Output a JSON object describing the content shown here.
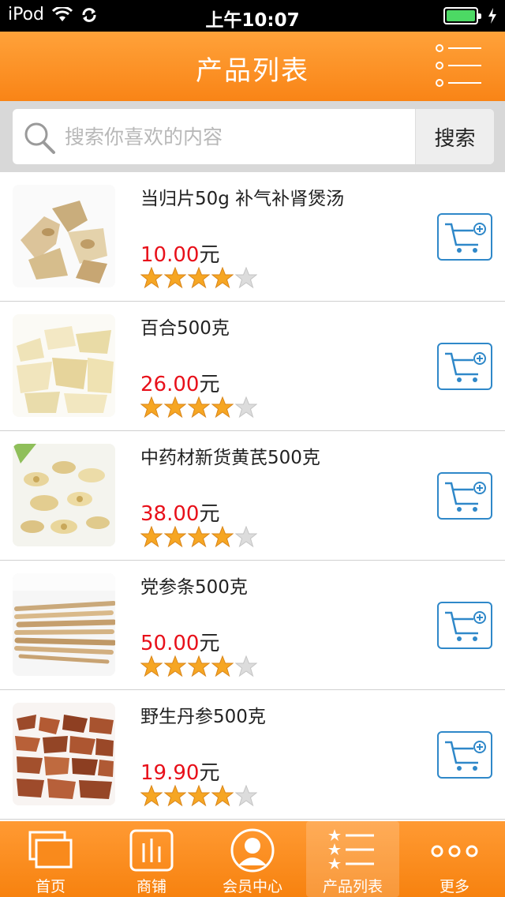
{
  "status_bar": {
    "carrier": "iPod",
    "time": "上午10:07"
  },
  "nav": {
    "title": "产品列表"
  },
  "search": {
    "placeholder": "搜索你喜欢的内容",
    "button_label": "搜索"
  },
  "products": [
    {
      "name": "当归片50g 补气补肾煲汤",
      "price": "10.00",
      "unit": "元",
      "rating": 4,
      "max_rating": 5
    },
    {
      "name": "百合500克",
      "price": "26.00",
      "unit": "元",
      "rating": 4,
      "max_rating": 5
    },
    {
      "name": "中药材新货黄芪500克",
      "price": "38.00",
      "unit": "元",
      "rating": 4,
      "max_rating": 5
    },
    {
      "name": "党参条500克",
      "price": "50.00",
      "unit": "元",
      "rating": 4,
      "max_rating": 5
    },
    {
      "name": "野生丹参500克",
      "price": "19.90",
      "unit": "元",
      "rating": 4,
      "max_rating": 5
    }
  ],
  "tabs": [
    {
      "label": "首页",
      "icon": "window-icon"
    },
    {
      "label": "商铺",
      "icon": "store-bars-icon"
    },
    {
      "label": "会员中心",
      "icon": "member-avatar-icon"
    },
    {
      "label": "产品列表",
      "icon": "star-list-icon",
      "active": true
    },
    {
      "label": "更多",
      "icon": "more-dots-icon"
    }
  ],
  "colors": {
    "accent": "#f98416",
    "price": "#e8101a",
    "cart_border": "#2f88c9",
    "battery": "#4cd964"
  }
}
